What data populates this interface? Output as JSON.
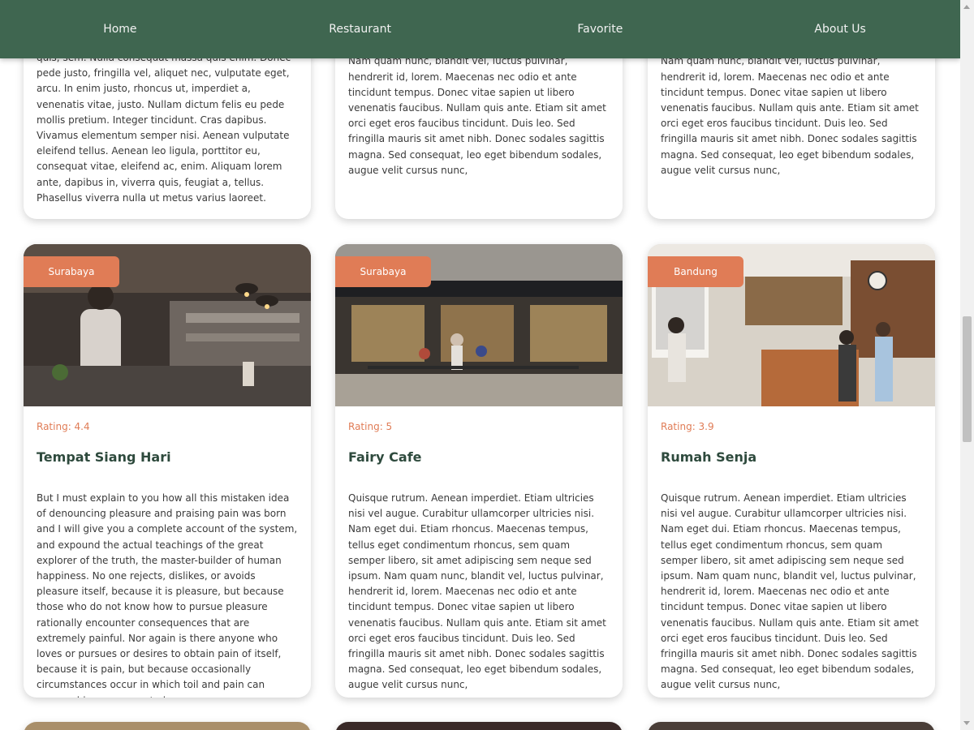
{
  "nav": {
    "items": [
      {
        "label": "Home"
      },
      {
        "label": "Restaurant"
      },
      {
        "label": "Favorite"
      },
      {
        "label": "About Us"
      }
    ]
  },
  "top_cards": [
    {
      "text": "quis, sem. Nulla consequat massa quis enim. Donec pede justo, fringilla vel, aliquet nec, vulputate eget, arcu. In enim justo, rhoncus ut, imperdiet a, venenatis vitae, justo. Nullam dictum felis eu pede mollis pretium. Integer tincidunt. Cras dapibus. Vivamus elementum semper nisi. Aenean vulputate eleifend tellus. Aenean leo ligula, porttitor eu, consequat vitae, eleifend ac, enim. Aliquam lorem ante, dapibus in, viverra quis, feugiat a, tellus. Phasellus viverra nulla ut metus varius laoreet."
    },
    {
      "text": "Nam quam nunc, blandit vel, luctus pulvinar, hendrerit id, lorem. Maecenas nec odio et ante tincidunt tempus. Donec vitae sapien ut libero venenatis faucibus. Nullam quis ante. Etiam sit amet orci eget eros faucibus tincidunt. Duis leo. Sed fringilla mauris sit amet nibh. Donec sodales sagittis magna. Sed consequat, leo eget bibendum sodales, augue velit cursus nunc,"
    },
    {
      "text": "Nam quam nunc, blandit vel, luctus pulvinar, hendrerit id, lorem. Maecenas nec odio et ante tincidunt tempus. Donec vitae sapien ut libero venenatis faucibus. Nullam quis ante. Etiam sit amet orci eget eros faucibus tincidunt. Duis leo. Sed fringilla mauris sit amet nibh. Donec sodales sagittis magna. Sed consequat, leo eget bibendum sodales, augue velit cursus nunc,"
    }
  ],
  "restaurants": [
    {
      "city": "Surabaya",
      "rating": "Rating: 4.4",
      "name": "Tempat Siang Hari",
      "description": "But I must explain to you how all this mistaken idea of denouncing pleasure and praising pain was born and I will give you a complete account of the system, and expound the actual teachings of the great explorer of the truth, the master-builder of human happiness. No one rejects, dislikes, or avoids pleasure itself, because it is pleasure, but because those who do not know how to pursue pleasure rationally encounter consequences that are extremely painful. Nor again is there anyone who loves or pursues or desires to obtain pain of itself, because it is pain, but because occasionally circumstances occur in which toil and pain can procure him some great pleasure."
    },
    {
      "city": "Surabaya",
      "rating": "Rating: 5",
      "name": "Fairy Cafe",
      "description": "Quisque rutrum. Aenean imperdiet. Etiam ultricies nisi vel augue. Curabitur ullamcorper ultricies nisi. Nam eget dui. Etiam rhoncus. Maecenas tempus, tellus eget condimentum rhoncus, sem quam semper libero, sit amet adipiscing sem neque sed ipsum. Nam quam nunc, blandit vel, luctus pulvinar, hendrerit id, lorem. Maecenas nec odio et ante tincidunt tempus. Donec vitae sapien ut libero venenatis faucibus. Nullam quis ante. Etiam sit amet orci eget eros faucibus tincidunt. Duis leo. Sed fringilla mauris sit amet nibh. Donec sodales sagittis magna. Sed consequat, leo eget bibendum sodales, augue velit cursus nunc,"
    },
    {
      "city": "Bandung",
      "rating": "Rating: 3.9",
      "name": "Rumah Senja",
      "description": "Quisque rutrum. Aenean imperdiet. Etiam ultricies nisi vel augue. Curabitur ullamcorper ultricies nisi. Nam eget dui. Etiam rhoncus. Maecenas tempus, tellus eget condimentum rhoncus, sem quam semper libero, sit amet adipiscing sem neque sed ipsum. Nam quam nunc, blandit vel, luctus pulvinar, hendrerit id, lorem. Maecenas nec odio et ante tincidunt tempus. Donec vitae sapien ut libero venenatis faucibus. Nullam quis ante. Etiam sit amet orci eget eros faucibus tincidunt. Duis leo. Sed fringilla mauris sit amet nibh. Donec sodales sagittis magna. Sed consequat, leo eget bibendum sodales, augue velit cursus nunc,"
    }
  ],
  "colors": {
    "navbar": "#3f6650",
    "accent": "#e07c56",
    "title": "#2e4a3d"
  }
}
